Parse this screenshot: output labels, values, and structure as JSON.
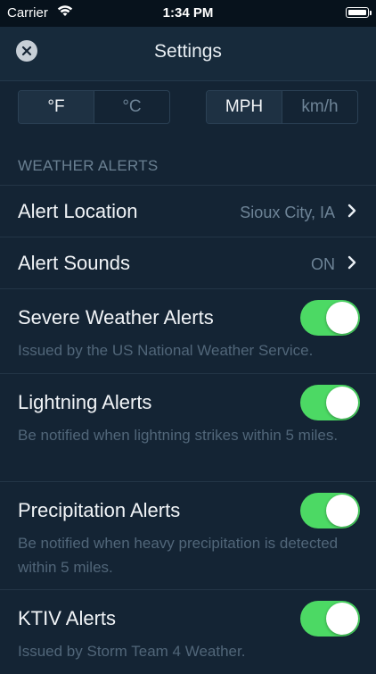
{
  "status_bar": {
    "carrier": "Carrier",
    "time": "1:34 PM",
    "wifi_icon": "wifi-icon",
    "battery_icon": "battery-icon"
  },
  "header": {
    "title": "Settings",
    "close_icon": "close-icon"
  },
  "units": {
    "temperature": {
      "options": [
        "°F",
        "°C"
      ],
      "selected": "°F"
    },
    "speed": {
      "options": [
        "MPH",
        "km/h"
      ],
      "selected": "MPH"
    }
  },
  "section": {
    "title": "WEATHER ALERTS"
  },
  "rows": [
    {
      "label": "Alert Location",
      "value": "Sioux City, IA",
      "icon": "chevron-right-icon"
    },
    {
      "label": "Alert Sounds",
      "value": "ON",
      "icon": "chevron-right-icon"
    }
  ],
  "toggles": [
    {
      "label": "Severe Weather Alerts",
      "description": "Issued by the US National Weather Service.",
      "on": true
    },
    {
      "label": "Lightning Alerts",
      "description": "Be notified when lightning strikes within 5 miles.",
      "on": true
    },
    {
      "label": "Precipitation Alerts",
      "description": "Be notified when heavy precipitation is detected within 5 miles.",
      "on": true
    },
    {
      "label": "KTIV Alerts",
      "description": "Issued by Storm Team 4 Weather.",
      "on": true
    }
  ],
  "colors": {
    "background": "#142434",
    "toggle_on": "#4cd964",
    "muted_text": "#6e8497"
  }
}
